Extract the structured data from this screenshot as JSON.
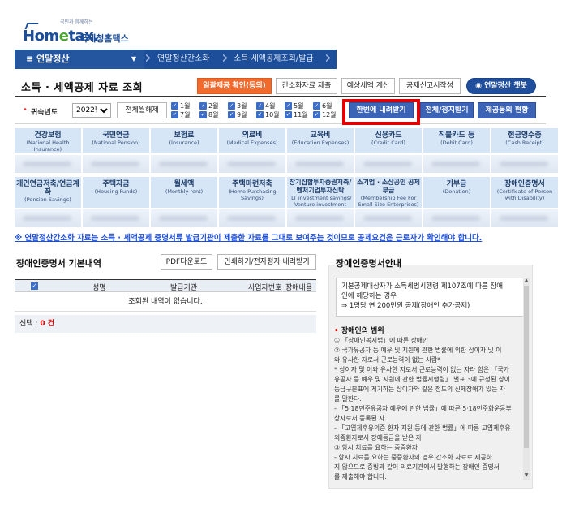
{
  "logo": {
    "tagline": "국민과 함께하는",
    "brand_a": "Hom",
    "brand_e": "e",
    "brand_b": "tax.",
    "sub": "국세청홈택스"
  },
  "nav": {
    "menu": "연말정산",
    "crumb1": "연말정산간소화",
    "crumb2": "소득·세액공제조회/발급"
  },
  "page_title": "소득 · 세액공제 자료 조회",
  "top_buttons": {
    "consent": "일괄제공 확인(동의)",
    "simple_submit": "간소화자료 제출",
    "tax_calc": "예상세액 계산",
    "deduction_form": "공제신고서작성",
    "chatbot": "연말정산 챗봇"
  },
  "filter": {
    "year_label": "귀속년도",
    "year_value": "2022년",
    "clear_all": "전체월해제",
    "months": [
      "1월",
      "2월",
      "3월",
      "4월",
      "5월",
      "6월",
      "7월",
      "8월",
      "9월",
      "10월",
      "11월",
      "12월"
    ],
    "download_all": "한번에 내려받기",
    "print_all": "전체/정지받기",
    "consent_status": "제공동의 현황"
  },
  "categories_row1": [
    {
      "ko": "건강보험",
      "en": "(National Health Insurance)"
    },
    {
      "ko": "국민연금",
      "en": "(National Pension)"
    },
    {
      "ko": "보험료",
      "en": "(Insurance)"
    },
    {
      "ko": "의료비",
      "en": "(Medical Expenses)"
    },
    {
      "ko": "교육비",
      "en": "(Education Expenses)"
    },
    {
      "ko": "신용카드",
      "en": "(Credit Card)"
    },
    {
      "ko": "직불카드 등",
      "en": "(Debit Card)"
    },
    {
      "ko": "현금영수증",
      "en": "(Cash Receipt)"
    }
  ],
  "categories_row2": [
    {
      "ko": "개인연금저축/연금계좌",
      "en": "(Pension Savings)"
    },
    {
      "ko": "주택자금",
      "en": "(Housing Funds)"
    },
    {
      "ko": "월세액",
      "en": "(Monthly rent)"
    },
    {
      "ko": "주택마련저축",
      "en": "(Home Purchasing Savings)"
    },
    {
      "ko": "장기집합투자증권저축/벤처기업투자신탁",
      "en": "(LT investment savings/ Venture investment fund)"
    },
    {
      "ko": "소기업 · 소상공인 공제부금",
      "en": "(Membership Fee For Small Size Enterprises)"
    },
    {
      "ko": "기부금",
      "en": "(Donation)"
    },
    {
      "ko": "장애인증명서",
      "en": "(Certificate of Person with Disability)"
    }
  ],
  "notice": "※ 연말정산간소화 자료는 소득 · 세액공제 증명서류 발급기관이 제출한 자료를 그대로 보여주는 것이므로 공제요건은 근로자가 확인해야 합니다.",
  "left": {
    "title": "장애인증명서 기본내역",
    "pdf_button": "PDF다운로드",
    "print_button": "인쇄하기/전자정자 내려받기",
    "columns": [
      "성명",
      "발급기관",
      "사업자번호",
      "장애내용"
    ],
    "empty": "조회된 내역이 없습니다.",
    "select_label": "선택 : ",
    "select_count": "0 건"
  },
  "right": {
    "title": "장애인증명서안내",
    "box_lines": [
      "기본공제대상자가 소득세법시행령 제107조에 따른 장애",
      "인에 해당하는 경우",
      "⇒ 1명당 연 200만원 공제(장애인 추가공제)"
    ],
    "range_title": "장애인의 범위",
    "range_lines": [
      "① 「장애인복지법」에 따른 장애인",
      "② 국가유공자 등 예우 및 지원에 관한 법률에 의한 상이자 및 이",
      "와 유사한 자로서 근로능력이 없는 사람*",
      "* 상이자 및 이와 유사한 자로서 근로능력이 없는 자라 함은 「국가",
      "유공자 등 예우 및 지원에 관한 법률시행령」 별표 3에 규정된 상이",
      "등급구분표에 게기하는 상이자와 같은 정도의 신체장애가 있는 자",
      "를 말한다.",
      "- 「5·18민주유공자 예우에 관한 법률」에 따른 5·18민주화운동부",
      "상자로서 등록된 자",
      "- 「고엽제후유의증 환자 지원 등에 관한 법률」에 따른 고엽제후유",
      "의증환자로서 장애등급을 받은 자",
      "③ 항시 치료를 요하는 중증환자",
      "- 항시 치료를 요하는 중증환자의 경우 간소화 자료로 제공하",
      "지 않으므로 증빙과 같이 의료기관에서 발행하는 장애인 증명서",
      "를 제출해야 합니다."
    ]
  }
}
